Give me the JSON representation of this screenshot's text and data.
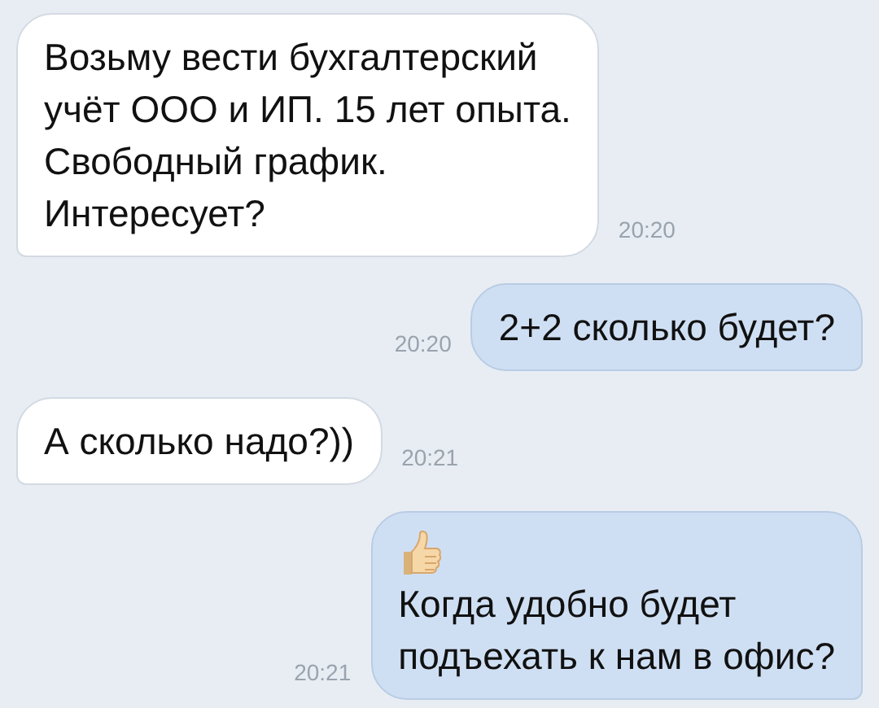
{
  "messages": [
    {
      "outgoing": false,
      "kind": "text",
      "lines": [
        "Возьму вести бухгалтерский",
        "учёт ООО и ИП. 15 лет опыта.",
        "Свободный график.",
        "Интересует?"
      ],
      "time": "20:20"
    },
    {
      "outgoing": true,
      "kind": "text",
      "lines": [
        "2+2 сколько будет?"
      ],
      "time": "20:20"
    },
    {
      "outgoing": false,
      "kind": "text",
      "lines": [
        "А сколько надо?))"
      ],
      "time": "20:21"
    },
    {
      "outgoing": true,
      "kind": "emoji_text",
      "lines": [
        "Когда удобно будет",
        "подъехать к нам в офис?"
      ],
      "time": "20:21"
    }
  ]
}
